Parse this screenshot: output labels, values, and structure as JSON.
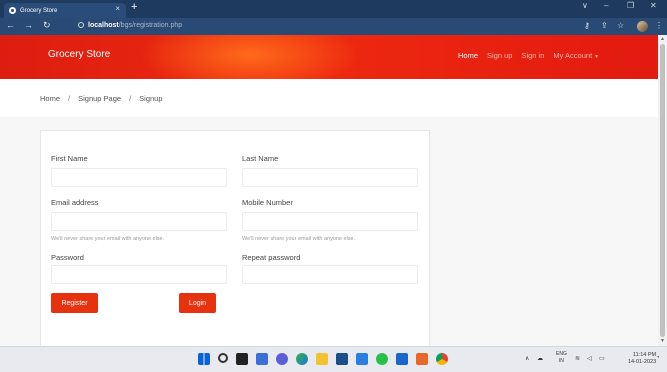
{
  "browser": {
    "tab_title": "Grocery Store",
    "tab_close": "×",
    "new_tab": "+",
    "url_host": "localhost",
    "url_path": "/bgs/registration.php",
    "win_min": "–",
    "win_restore": "❐",
    "win_close": "✕",
    "win_down": "∨"
  },
  "navbar": {
    "brand": "Grocery Store",
    "links": [
      "Home",
      "Sign up",
      "Sign in",
      "My Account"
    ]
  },
  "breadcrumb": {
    "items": [
      "Home",
      "Signup Page",
      "Signup"
    ],
    "separator": "/"
  },
  "form": {
    "first_name_label": "First Name",
    "last_name_label": "Last Name",
    "email_label": "Email address",
    "mobile_label": "Mobile Number",
    "email_hint": "We'll never share your email with anyone else.",
    "mobile_hint": "We'll never share your email with anyone else.",
    "password_label": "Password",
    "repeat_password_label": "Repeat password",
    "register_button": "Register",
    "login_button": "Login"
  },
  "taskbar": {
    "lang_top": "ENG",
    "lang_bottom": "IN",
    "time": "11:14 PM",
    "date": "14-01-2023"
  },
  "colors": {
    "accent": "#e7320f",
    "navbar": "#e21a10",
    "browser_chrome": "#284a74"
  }
}
